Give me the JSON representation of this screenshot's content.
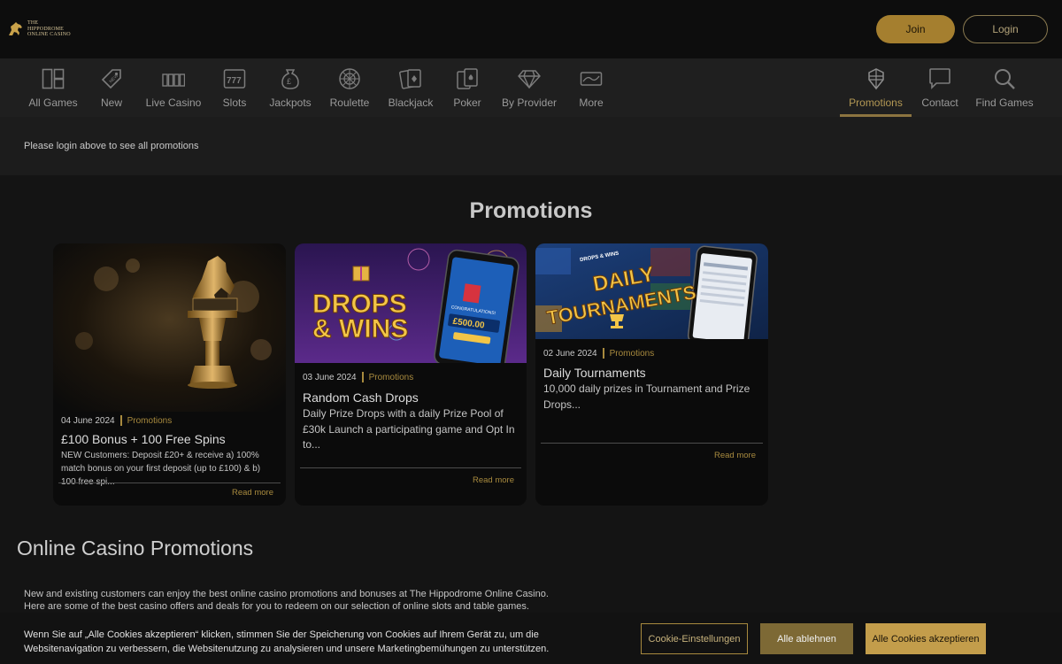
{
  "header": {
    "logo_lines": [
      "The",
      "Hippodrome",
      "Online Casino"
    ],
    "join_label": "Join",
    "login_label": "Login"
  },
  "nav": {
    "items": [
      {
        "label": "All Games",
        "icon": "all-games-icon"
      },
      {
        "label": "New",
        "icon": "new-tag-icon"
      },
      {
        "label": "Live Casino",
        "icon": "live-casino-chips-icon"
      },
      {
        "label": "Slots",
        "icon": "slots-777-icon"
      },
      {
        "label": "Jackpots",
        "icon": "jackpot-coin-icon"
      },
      {
        "label": "Roulette",
        "icon": "roulette-wheel-icon"
      },
      {
        "label": "Blackjack",
        "icon": "blackjack-cards-icon"
      },
      {
        "label": "Poker",
        "icon": "poker-cards-icon"
      },
      {
        "label": "By Provider",
        "icon": "diamond-icon"
      },
      {
        "label": "More",
        "icon": "more-ticket-icon"
      }
    ],
    "right_items": [
      {
        "label": "Promotions",
        "icon": "promotions-gift-icon",
        "active": true
      },
      {
        "label": "Contact",
        "icon": "chat-bubble-icon"
      },
      {
        "label": "Find Games",
        "icon": "search-icon"
      }
    ]
  },
  "notice": "Please login above to see all promotions",
  "promotions": {
    "heading": "Promotions",
    "read_more": "Read more",
    "cards": [
      {
        "date": "04 June 2024",
        "category": "Promotions",
        "title": "£100 Bonus + 100 Free Spins",
        "description": "NEW Customers: Deposit £20+ & receive a) 100% match bonus on your first deposit (up to £100) & b) 100 free spi..."
      },
      {
        "date": "03 June 2024",
        "category": "Promotions",
        "title": "Random Cash Drops",
        "description": "Daily Prize Drops with a daily Prize Pool of £30k Launch a participating game and Opt In to...",
        "image_text": {
          "line1": "DROPS",
          "line2": "& WINS",
          "phone_line1": "CONGRATULATIONS!",
          "phone_amount": "£500.00"
        }
      },
      {
        "date": "02 June 2024",
        "category": "Promotions",
        "title": "Daily Tournaments",
        "description": "10,000 daily prizes in Tournament and Prize Drops...",
        "image_text": {
          "badge": "DROPS & WINS",
          "line1": "DAILY",
          "line2": "TOURNAMENTS"
        }
      }
    ]
  },
  "online_promos": {
    "heading": "Online Casino Promotions",
    "intro": "New and existing customers can enjoy the best online casino promotions and bonuses at The Hippodrome Online Casino. Here are some of the best casino offers and deals for you to redeem on our selection of online slots and table games."
  },
  "cookie": {
    "text": "Wenn Sie auf „Alle Cookies akzeptieren“ klicken, stimmen Sie der Speicherung von Cookies auf Ihrem Gerät zu, um die Websitenavigation zu verbessern, die Websitenutzung zu analysieren und unsere Marketingbemühungen zu unterstützen.",
    "settings_label": "Cookie-Einstellungen",
    "deny_label": "Alle ablehnen",
    "accept_label": "Alle Cookies akzeptieren"
  },
  "colors": {
    "gold": "#a57f2f",
    "gold_text": "#a88a3e",
    "accept": "#c39d4b",
    "background": "#141414"
  }
}
